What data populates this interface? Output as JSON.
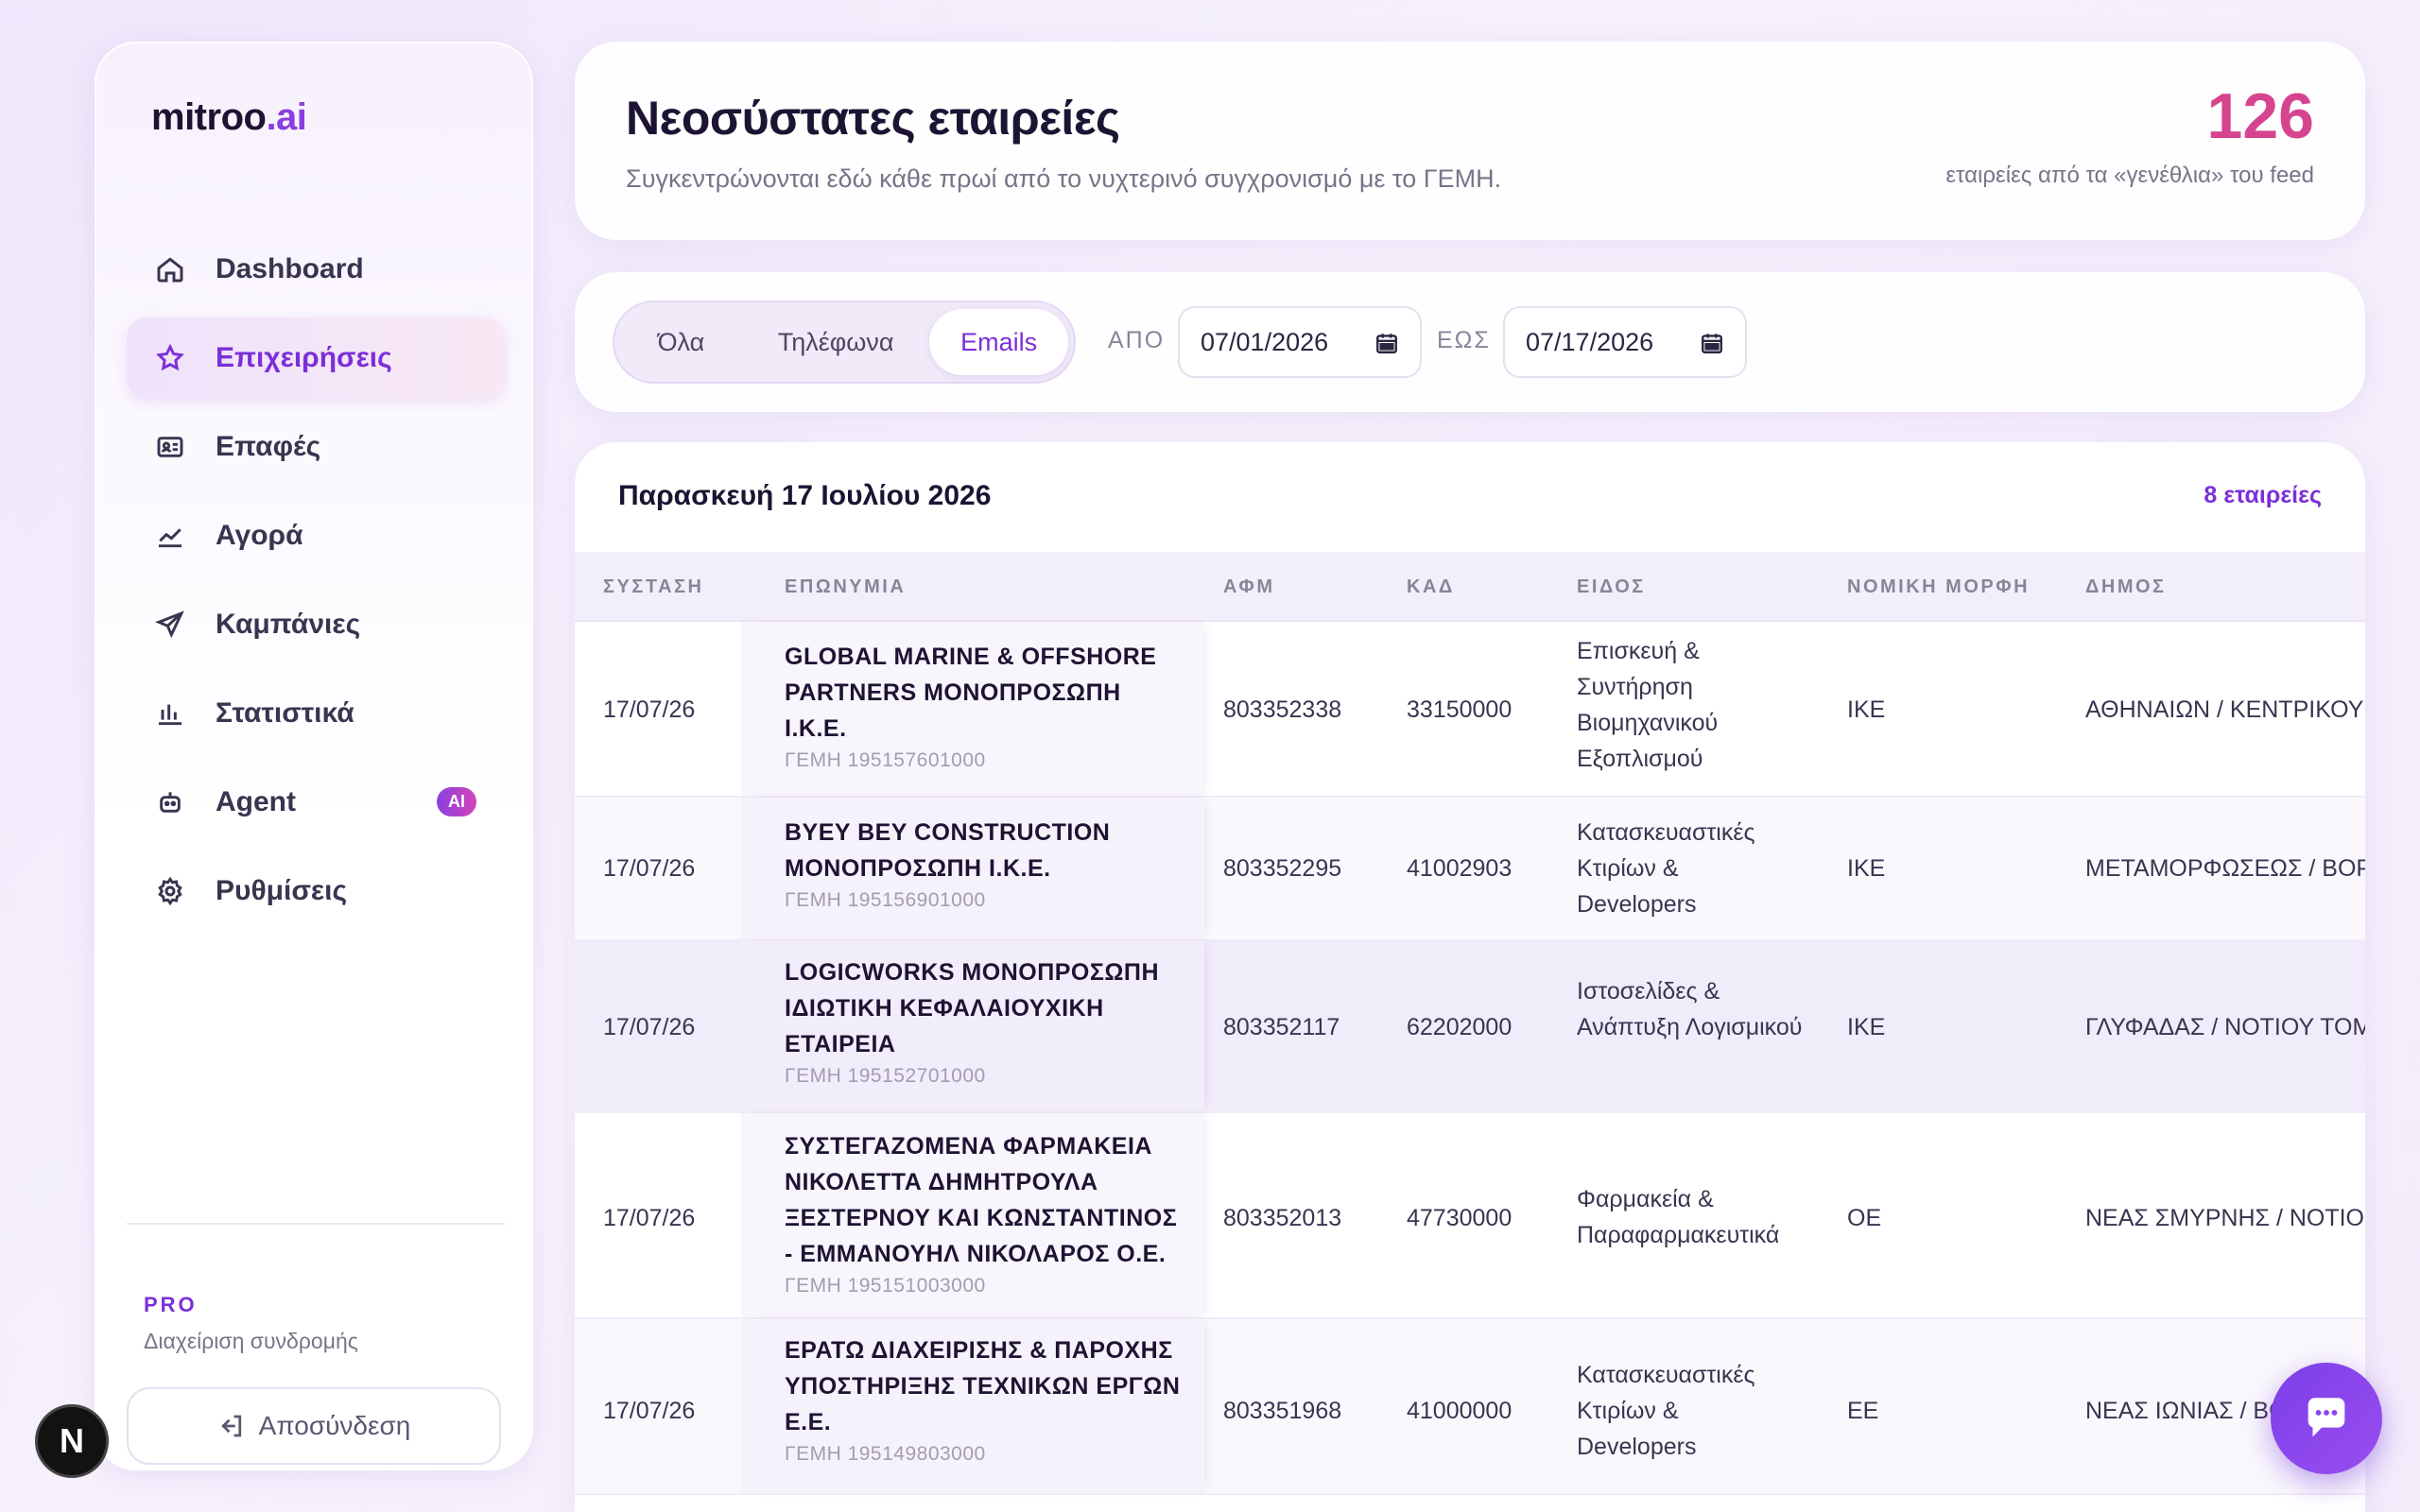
{
  "brand": {
    "name": "mitroo",
    "suffix": ".ai"
  },
  "sidebar": {
    "items": [
      {
        "label": "Dashboard",
        "icon": "home-icon",
        "active": false
      },
      {
        "label": "Επιχειρήσεις",
        "icon": "star-icon",
        "active": true
      },
      {
        "label": "Επαφές",
        "icon": "contact-card-icon",
        "active": false
      },
      {
        "label": "Αγορά",
        "icon": "trend-line-icon",
        "active": false
      },
      {
        "label": "Καμπάνιες",
        "icon": "send-icon",
        "active": false
      },
      {
        "label": "Στατιστικά",
        "icon": "bar-chart-icon",
        "active": false
      },
      {
        "label": "Agent",
        "icon": "robot-icon",
        "active": false,
        "badge": "AI"
      },
      {
        "label": "Ρυθμίσεις",
        "icon": "gear-icon",
        "active": false
      }
    ],
    "plan": "PRO",
    "manage_subscription": "Διαχείριση συνδρομής",
    "logout": "Αποσύνδεση"
  },
  "header": {
    "title": "Νεοσύστατες εταιρείες",
    "subtitle": "Συγκεντρώνονται εδώ κάθε πρωί από το νυχτερινό συγχρονισμό με το ΓΕΜΗ.",
    "count": "126",
    "count_label": "εταιρείες από τα «γενέθλια» του feed"
  },
  "filters": {
    "segments": [
      "Όλα",
      "Τηλέφωνα",
      "Emails"
    ],
    "selected_segment": "Emails",
    "from_label": "ΑΠΟ",
    "from_value": "07/01/2026",
    "to_label": "ΕΩΣ",
    "to_value": "07/17/2026"
  },
  "table": {
    "day_title": "Παρασκευή 17 Ιουλίου 2026",
    "day_count": "8 εταιρείες",
    "columns": [
      "ΣΥΣΤΑΣΗ",
      "ΕΠΩΝΥΜΙΑ",
      "ΑΦΜ",
      "ΚΑΔ",
      "ΕΙΔΟΣ",
      "ΝΟΜΙΚΗ ΜΟΡΦΗ",
      "ΔΗΜΟΣ"
    ],
    "rows": [
      {
        "date": "17/07/26",
        "name": "GLOBAL MARINE & OFFSHORE PARTNERS ΜΟΝΟΠΡΟΣΩΠΗ Ι.Κ.Ε.",
        "gemh": "ΓΕΜΗ 195157601000",
        "afm": "803352338",
        "kad": "33150000",
        "eidos": "Επισκευή & Συντήρηση Βιομηχανικού Εξοπλισμού",
        "morfi": "ΙΚΕ",
        "dimos": "ΑΘΗΝΑΙΩΝ / ΚΕΝΤΡΙΚΟΥ"
      },
      {
        "date": "17/07/26",
        "name": "BYEY BEY CONSTRUCTION ΜΟΝΟΠΡΟΣΩΠΗ Ι.Κ.Ε.",
        "gemh": "ΓΕΜΗ 195156901000",
        "afm": "803352295",
        "kad": "41002903",
        "eidos": "Κατασκευαστικές Κτιρίων & Developers",
        "morfi": "ΙΚΕ",
        "dimos": "ΜΕΤΑΜΟΡΦΩΣΕΩΣ / ΒΟΡ"
      },
      {
        "date": "17/07/26",
        "name": "LOGICWORKS ΜΟΝΟΠΡΟΣΩΠΗ ΙΔΙΩΤΙΚΗ ΚΕΦΑΛΑΙΟΥΧΙΚΗ ΕΤΑΙΡΕΙΑ",
        "gemh": "ΓΕΜΗ 195152701000",
        "afm": "803352117",
        "kad": "62202000",
        "eidos": "Ιστοσελίδες & Ανάπτυξη Λογισμικού",
        "morfi": "ΙΚΕ",
        "dimos": "ΓΛΥΦΑΔΑΣ / ΝΟΤΙΟΥ ΤΟΜ"
      },
      {
        "date": "17/07/26",
        "name": "ΣΥΣΤΕΓΑΖΟΜΕΝΑ ΦΑΡΜΑΚΕΙΑ ΝΙΚΟΛΕΤΤΑ ΔΗΜΗΤΡΟΥΛΑ ΞΕΣΤΕΡΝΟΥ ΚΑΙ ΚΩΝΣΤΑΝΤΙΝΟΣ - ΕΜΜΑΝΟΥΗΛ ΝΙΚΟΛΑΡΟΣ Ο.Ε.",
        "gemh": "ΓΕΜΗ 195151003000",
        "afm": "803352013",
        "kad": "47730000",
        "eidos": "Φαρμακεία & Παραφαρμακευτικά",
        "morfi": "ΟΕ",
        "dimos": "ΝΕΑΣ ΣΜΥΡΝΗΣ / ΝΟΤΙΟ"
      },
      {
        "date": "17/07/26",
        "name": "ΕΡΑΤΩ ΔΙΑΧΕΙΡΙΣΗΣ & ΠΑΡΟΧΗΣ ΥΠΟΣΤΗΡΙΞΗΣ ΤΕΧΝΙΚΩΝ ΕΡΓΩΝ Ε.Ε.",
        "gemh": "ΓΕΜΗ 195149803000",
        "afm": "803351968",
        "kad": "41000000",
        "eidos": "Κατασκευαστικές Κτιρίων & Developers",
        "morfi": "ΕΕ",
        "dimos": "ΝΕΑΣ ΙΩΝΙΑΣ / ΒΟ"
      }
    ]
  },
  "colors": {
    "accent": "#7b2fd8",
    "count": "#d6448f",
    "chat": "#8a45ec"
  },
  "floating": {
    "next_badge": "N"
  }
}
